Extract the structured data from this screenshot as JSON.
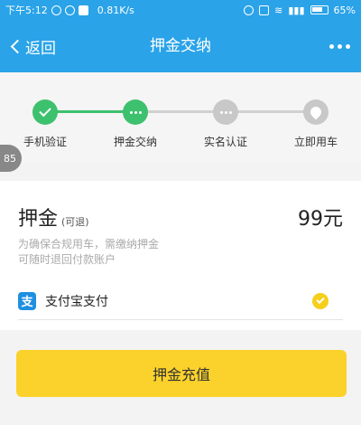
{
  "status_bar": {
    "time": "下午5:12",
    "network_speed": "0.81K/s",
    "battery": "65%"
  },
  "nav": {
    "back_label": "返回",
    "title": "押金交纳"
  },
  "steps": {
    "items": [
      {
        "label": "手机验证",
        "state": "done",
        "icon": "check-icon"
      },
      {
        "label": "押金交纳",
        "state": "current",
        "icon": "more-dots-icon"
      },
      {
        "label": "实名认证",
        "state": "pending",
        "icon": "more-dots-icon"
      },
      {
        "label": "立即用车",
        "state": "pending",
        "icon": "location-pin-icon"
      }
    ],
    "colors": {
      "done": "#3ec16e",
      "current": "#3ec16e",
      "pending": "#c8c8c8"
    }
  },
  "side_badge": "85",
  "deposit": {
    "title": "押金",
    "subtitle": "(可退)",
    "amount": "99元",
    "desc_line1": "为确保合规用车，需缴纳押金",
    "desc_line2": "可随时退回付款账户"
  },
  "payment": {
    "icon_glyph": "支",
    "label": "支付宝支付",
    "selected": true
  },
  "submit_label": "押金充值",
  "colors": {
    "header": "#2aa3e8",
    "button": "#fbd22b",
    "step_green": "#3ec16e",
    "step_gray": "#c8c8c8",
    "alipay": "#1e8fe1"
  }
}
